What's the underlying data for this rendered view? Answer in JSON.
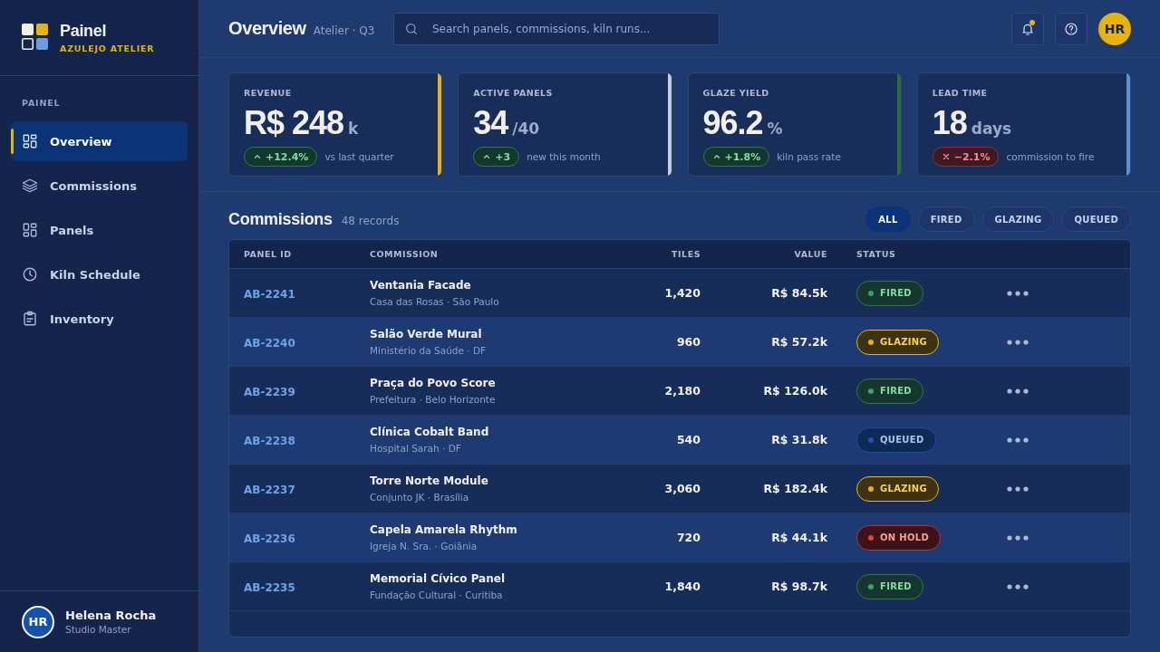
{
  "brand": {
    "name": "Painel",
    "subtitle": "AZULEJO ATELIER"
  },
  "sidebar": {
    "section": "PAINEL",
    "items": [
      {
        "label": "Overview",
        "kind": "grid",
        "selected": true
      },
      {
        "label": "Commissions",
        "kind": "layers",
        "selected": false
      },
      {
        "label": "Panels",
        "kind": "grid",
        "selected": false
      },
      {
        "label": "Kiln Schedule",
        "kind": "clock",
        "selected": false
      },
      {
        "label": "Inventory",
        "kind": "clipboard",
        "selected": false
      }
    ]
  },
  "user": {
    "initials": "HR",
    "name": "Helena Rocha",
    "role": "Studio Master"
  },
  "header": {
    "title": "Overview",
    "subtitle": "Atelier · Q3",
    "search_placeholder": "Search panels, commissions, kiln runs...",
    "notification": true,
    "avatar": "HR"
  },
  "kpis": [
    {
      "label": "REVENUE",
      "value": "R$ 248",
      "unit": "k",
      "delta": "+12.4%",
      "kind": "up",
      "note": "vs last quarter",
      "color": "#e8b400"
    },
    {
      "label": "ACTIVE PANELS",
      "value": "34",
      "unit": "/40",
      "delta": "+3",
      "kind": "up",
      "note": "new this month",
      "color": "#c8ccd6"
    },
    {
      "label": "GLAZE YIELD",
      "value": "96.2",
      "unit": "%",
      "delta": "+1.8%",
      "kind": "up",
      "note": "kiln pass rate",
      "color": "#2e6b3a"
    },
    {
      "label": "LEAD TIME",
      "value": "18",
      "unit": "days",
      "delta": "−2.1%",
      "kind": "down",
      "note": "commission to fire",
      "color": "#5b8fd6"
    }
  ],
  "commissions": {
    "title": "Commissions",
    "count": "48 records",
    "filters": [
      {
        "label": "ALL",
        "selected": true
      },
      {
        "label": "FIRED",
        "selected": false
      },
      {
        "label": "GLAZING",
        "selected": false
      },
      {
        "label": "QUEUED",
        "selected": false
      }
    ],
    "columns": [
      "PANEL ID",
      "COMMISSION",
      "TILES",
      "VALUE",
      "STATUS"
    ],
    "rows": [
      {
        "id": "AB-2241",
        "name": "Ventania Facade",
        "client": "Casa das Rosas · São Paulo",
        "tiles": "1,420",
        "value": "R$ 84.5k",
        "status": "FIRED",
        "kind": "fired"
      },
      {
        "id": "AB-2240",
        "name": "Salão Verde Mural",
        "client": "Ministério da Saúde · DF",
        "tiles": "960",
        "value": "R$ 57.2k",
        "status": "GLAZING",
        "kind": "glazing"
      },
      {
        "id": "AB-2239",
        "name": "Praça do Povo Score",
        "client": "Prefeitura · Belo Horizonte",
        "tiles": "2,180",
        "value": "R$ 126.0k",
        "status": "FIRED",
        "kind": "fired"
      },
      {
        "id": "AB-2238",
        "name": "Clínica Cobalt Band",
        "client": "Hospital Sarah · DF",
        "tiles": "540",
        "value": "R$ 31.8k",
        "status": "QUEUED",
        "kind": "queued"
      },
      {
        "id": "AB-2237",
        "name": "Torre Norte Module",
        "client": "Conjunto JK · Brasília",
        "tiles": "3,060",
        "value": "R$ 182.4k",
        "status": "GLAZING",
        "kind": "glazing"
      },
      {
        "id": "AB-2236",
        "name": "Capela Amarela Rhythm",
        "client": "Igreja N. Sra. · Goiânia",
        "tiles": "720",
        "value": "R$ 44.1k",
        "status": "ON HOLD",
        "kind": "hold"
      },
      {
        "id": "AB-2235",
        "name": "Memorial Cívico Panel",
        "client": "Fundação Cultural · Curitiba",
        "tiles": "1,840",
        "value": "R$ 98.7k",
        "status": "FIRED",
        "kind": "fired"
      }
    ]
  }
}
